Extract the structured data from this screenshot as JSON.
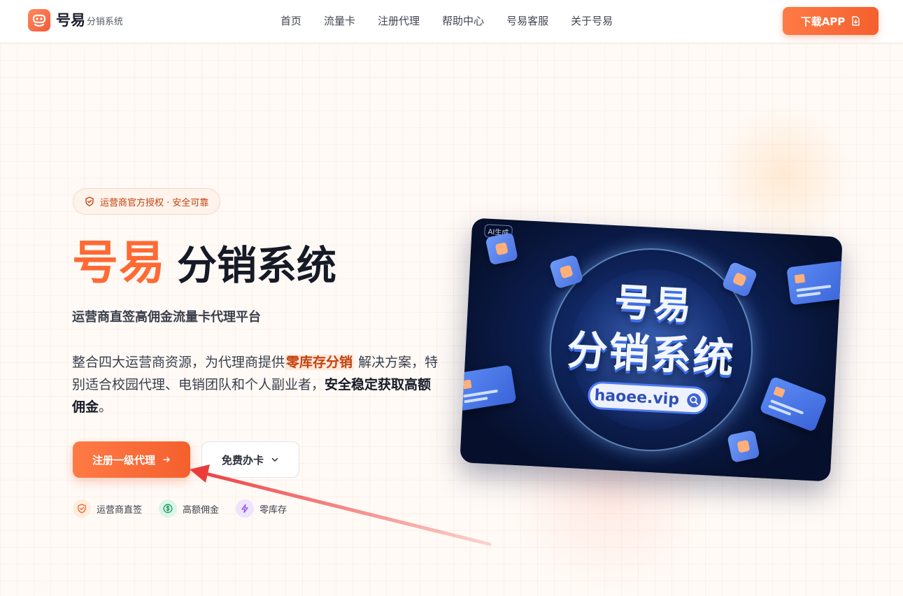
{
  "header": {
    "brand_name": "号易",
    "brand_sub": "分销系统",
    "nav": [
      "首页",
      "流量卡",
      "注册代理",
      "帮助中心",
      "号易客服",
      "关于号易"
    ],
    "download_label": "下载APP"
  },
  "hero": {
    "badge": "运营商官方授权 · 安全可靠",
    "title_strong": "号易",
    "title_rest": "分销系统",
    "subtitle": "运营商直签高佣金流量卡代理平台",
    "desc_part1": "整合四大运营商资源，为代理商提供",
    "desc_highlight": "零库存分销",
    "desc_part2": "解决方案，特别适合校园代理、电销团队和个人副业者，",
    "desc_strong": "安全稳定获取高额佣金",
    "desc_end": "。",
    "primary_btn": "注册一级代理",
    "secondary_btn": "免费办卡",
    "features": [
      {
        "label": "运营商直签",
        "icon": "shield-icon"
      },
      {
        "label": "高额佣金",
        "icon": "dollar-icon"
      },
      {
        "label": "零库存",
        "icon": "lightning-icon"
      }
    ]
  },
  "hero_image": {
    "ai_tag": "AI生成",
    "line1": "号易",
    "line2": "分销系统",
    "url": "haoee.vip"
  },
  "colors": {
    "accent": "#f4602e",
    "accent_light": "#ff7a45",
    "text_dark": "#161a26",
    "highlight_text": "#c2410c",
    "annotation_arrow": "#ec3b3b"
  }
}
